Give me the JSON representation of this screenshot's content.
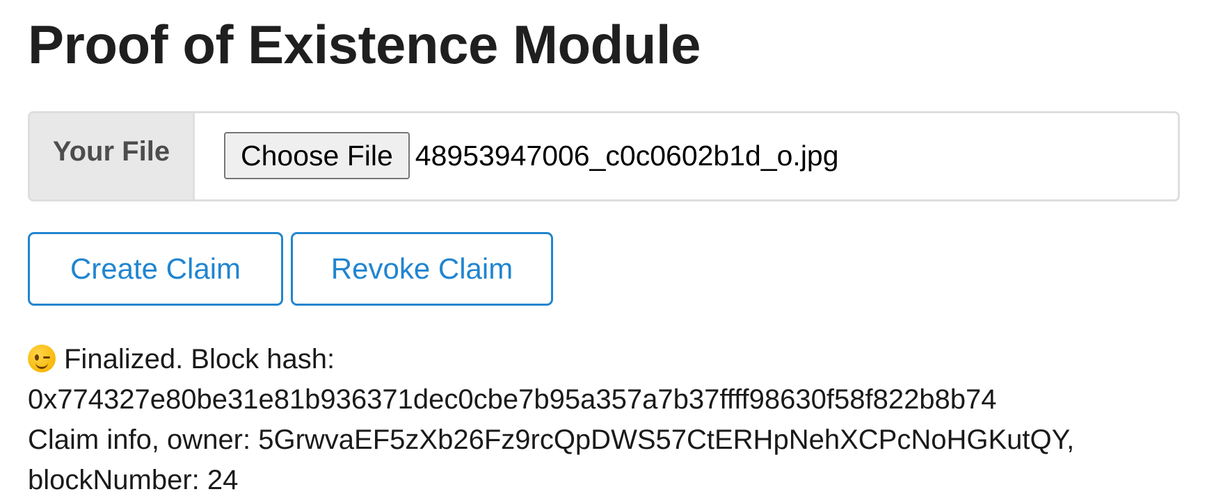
{
  "title": "Proof of Existence Module",
  "file_input": {
    "label": "Your File",
    "button_label": "Choose File",
    "file_name": "48953947006_c0c0602b1d_o.jpg"
  },
  "buttons": {
    "create": "Create Claim",
    "revoke": "Revoke Claim"
  },
  "status": {
    "emoji_icon": "winking-face-icon",
    "line1": "Finalized. Block hash:",
    "line2": "0x774327e80be31e81b936371dec0cbe7b95a357a7b37ffff98630f58f822b8b74",
    "line3": "Claim info, owner: 5GrwvaEF5zXb26Fz9rcQpDWS57CtERHpNehXCPcNoHGKutQY,",
    "line4": "blockNumber: 24"
  },
  "colors": {
    "accent": "#2185d0",
    "label_bg": "#e8e8e8",
    "border": "#dedede"
  }
}
